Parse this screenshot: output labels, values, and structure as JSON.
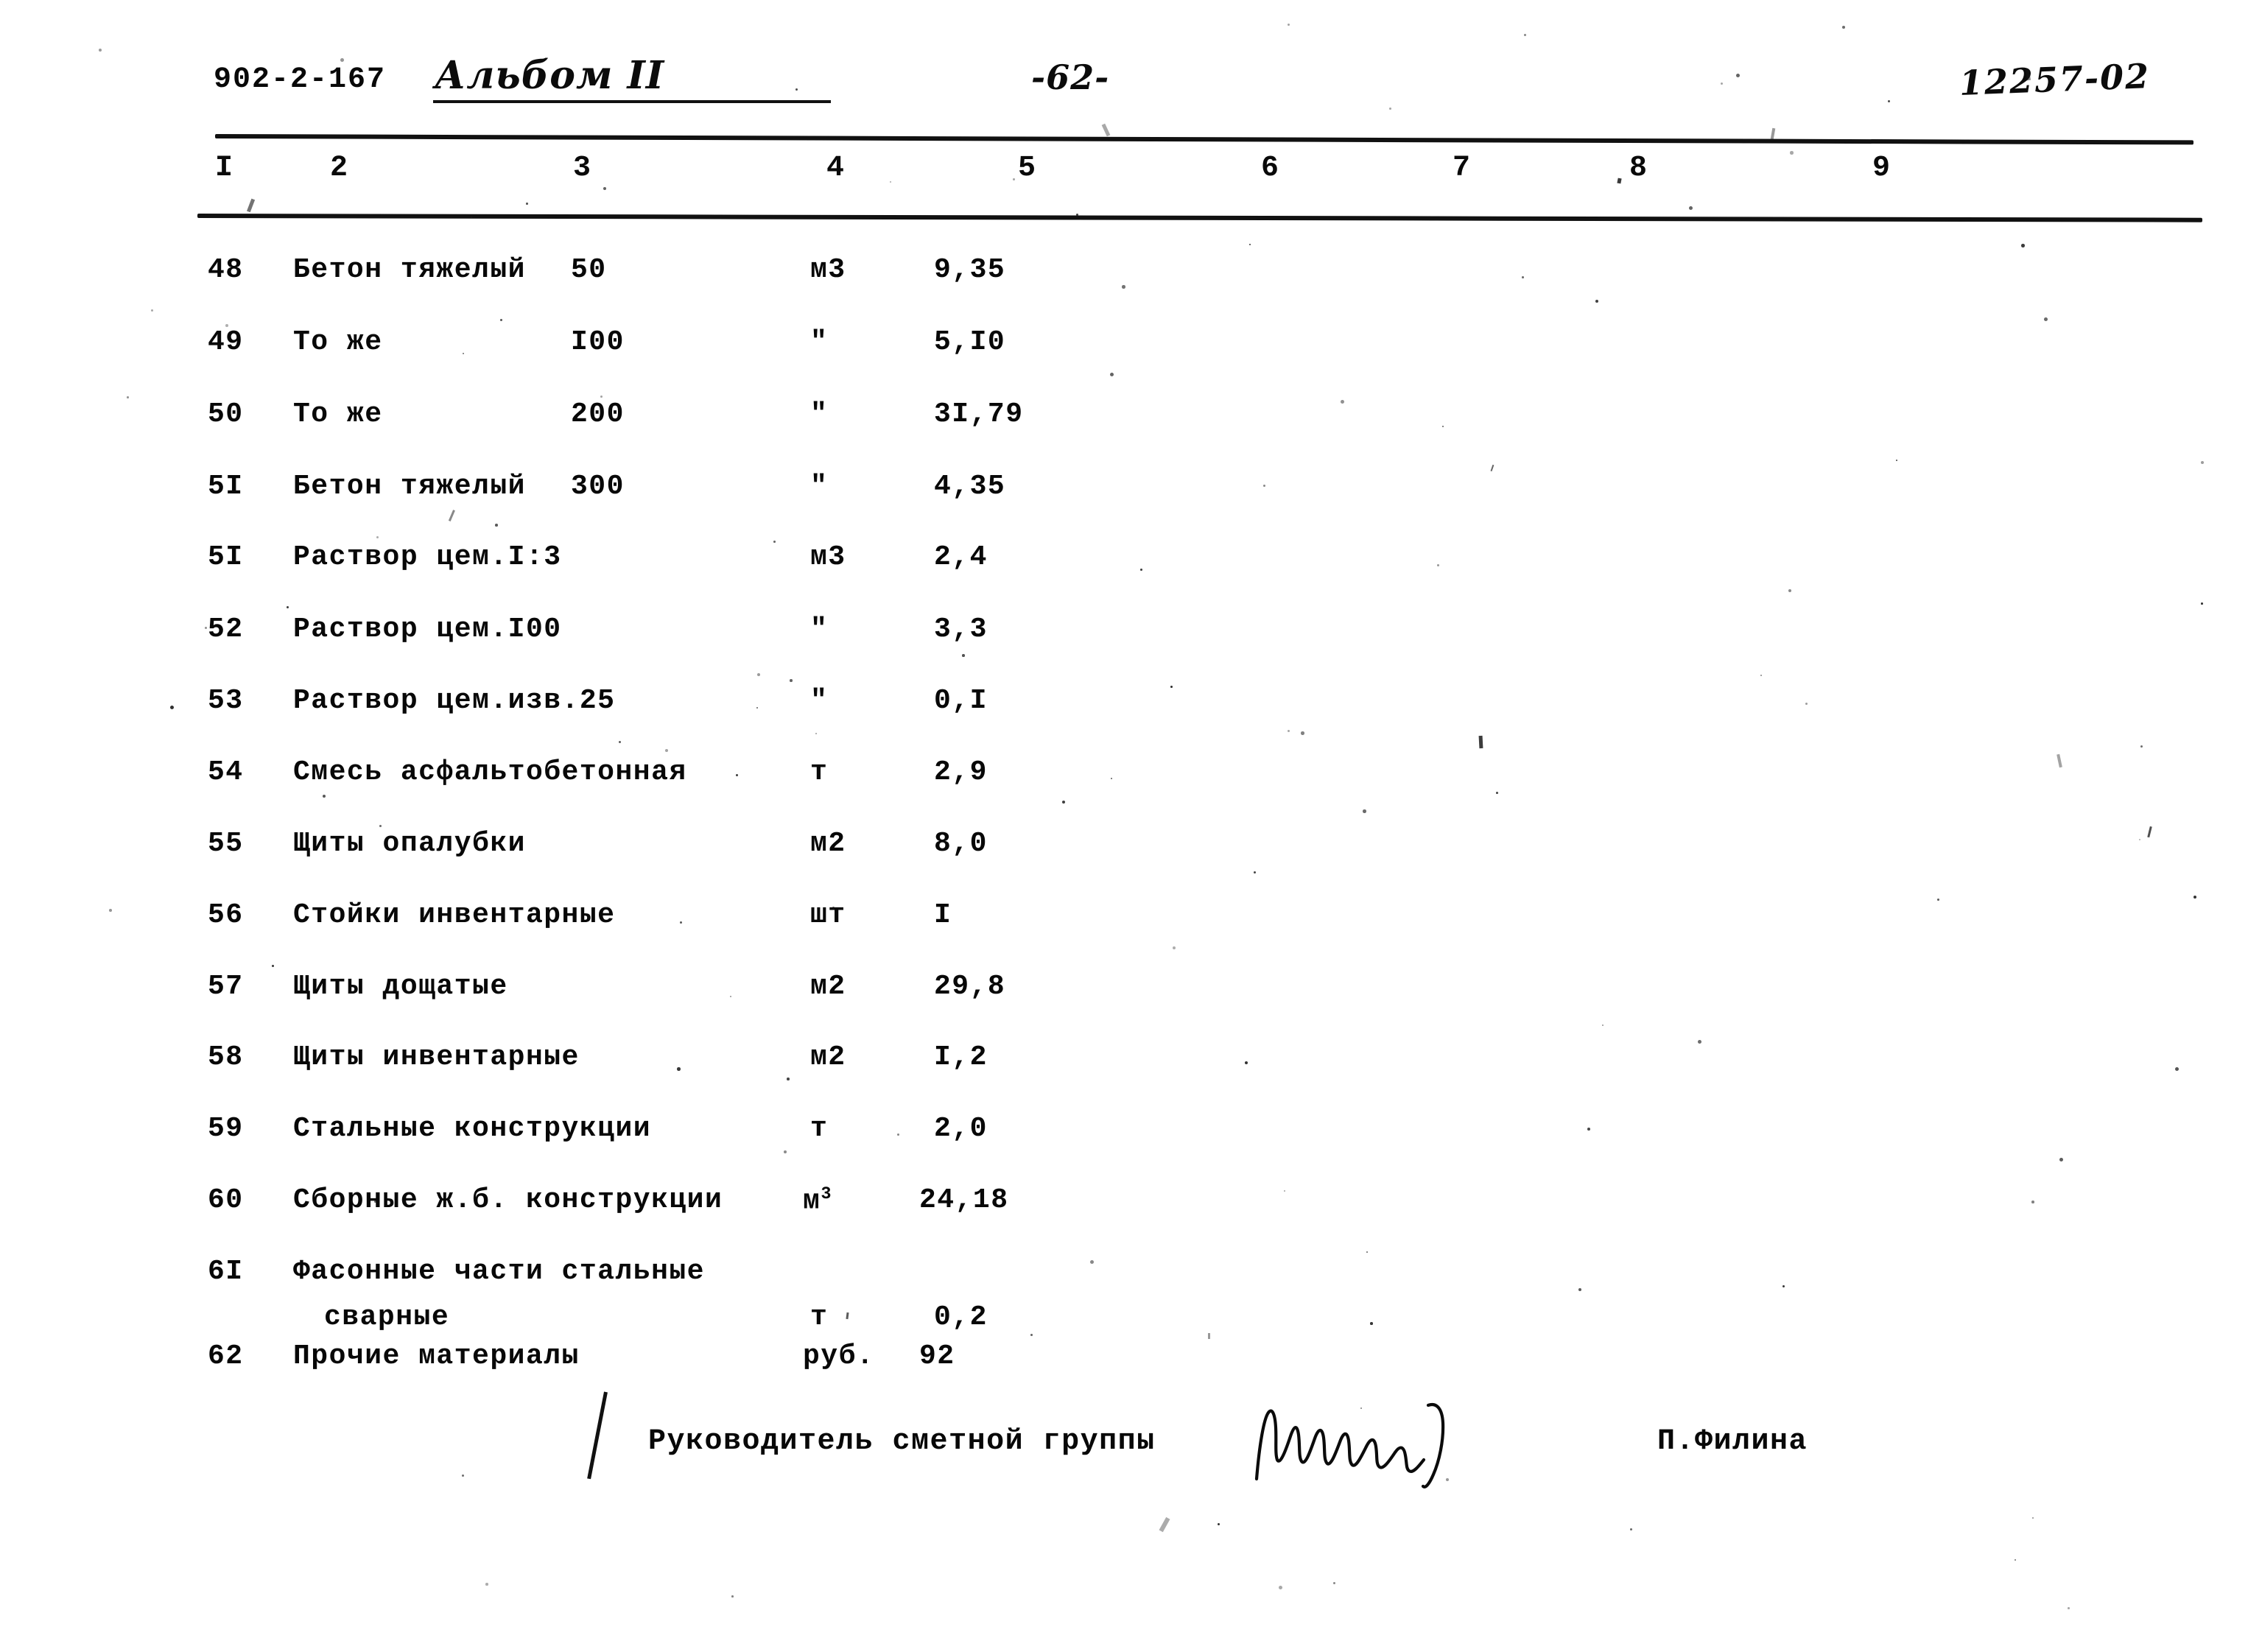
{
  "header": {
    "project_code": "902-2-167",
    "album_label": "Альбом II",
    "page_number": "-62-",
    "stamp_number": "12257-02"
  },
  "table": {
    "column_numbers": [
      "I",
      "2",
      "3",
      "4",
      "5",
      "6",
      "7",
      "8",
      "9"
    ],
    "rows": [
      {
        "no": "48",
        "name": "Бетон тяжелый",
        "name_cont": "",
        "grade": "50",
        "unit": "м3",
        "qty": "9,35"
      },
      {
        "no": "49",
        "name": "То же",
        "name_cont": "",
        "grade": "I00",
        "unit": "\"",
        "qty": "5,I0"
      },
      {
        "no": "50",
        "name": "То же",
        "name_cont": "",
        "grade": "200",
        "unit": "\"",
        "qty": "3I,79"
      },
      {
        "no": "5I",
        "name": "Бетон тяжелый",
        "name_cont": "",
        "grade": "300",
        "unit": "\"",
        "qty": "4,35"
      },
      {
        "no": "5I",
        "name": "Раствор цем.I:3",
        "name_cont": "",
        "grade": "",
        "unit": "м3",
        "qty": "2,4"
      },
      {
        "no": "52",
        "name": "Раствор цем.I00",
        "name_cont": "",
        "grade": "",
        "unit": "\"",
        "qty": "3,3"
      },
      {
        "no": "53",
        "name": "Раствор цем.изв.25",
        "name_cont": "",
        "grade": "",
        "unit": "\"",
        "qty": "0,I"
      },
      {
        "no": "54",
        "name": "Смесь асфальтобетонная",
        "name_cont": "",
        "grade": "",
        "unit": "т",
        "qty": "2,9"
      },
      {
        "no": "55",
        "name": "Щиты опалубки",
        "name_cont": "",
        "grade": "",
        "unit": "м2",
        "qty": "8,0"
      },
      {
        "no": "56",
        "name": "Стойки инвентарные",
        "name_cont": "",
        "grade": "",
        "unit": "шт",
        "qty": "I"
      },
      {
        "no": "57",
        "name": "Щиты дощатые",
        "name_cont": "",
        "grade": "",
        "unit": "м2",
        "qty": "29,8"
      },
      {
        "no": "58",
        "name": "Щиты инвентарные",
        "name_cont": "",
        "grade": "",
        "unit": "м2",
        "qty": "I,2"
      },
      {
        "no": "59",
        "name": "Стальные конструкции",
        "name_cont": "",
        "grade": "",
        "unit": "т",
        "qty": "2,0"
      },
      {
        "no": "60",
        "name": "Сборные ж.б. конструкции",
        "name_cont": "",
        "grade": "",
        "unit": "м3_sup",
        "qty": "24,18"
      },
      {
        "no": "6I",
        "name": "Фасонные части стальные",
        "name_cont": "сварные",
        "grade": "",
        "unit": "т",
        "qty": "0,2"
      },
      {
        "no": "62",
        "name": "Прочие материалы",
        "name_cont": "",
        "grade": "",
        "unit": "руб.",
        "qty": "92"
      }
    ]
  },
  "signature": {
    "title": "Руководитель сметной группы",
    "name": "П.Филина"
  },
  "colors": {
    "ink": "#0a0a0a",
    "paper": "#ffffff"
  }
}
